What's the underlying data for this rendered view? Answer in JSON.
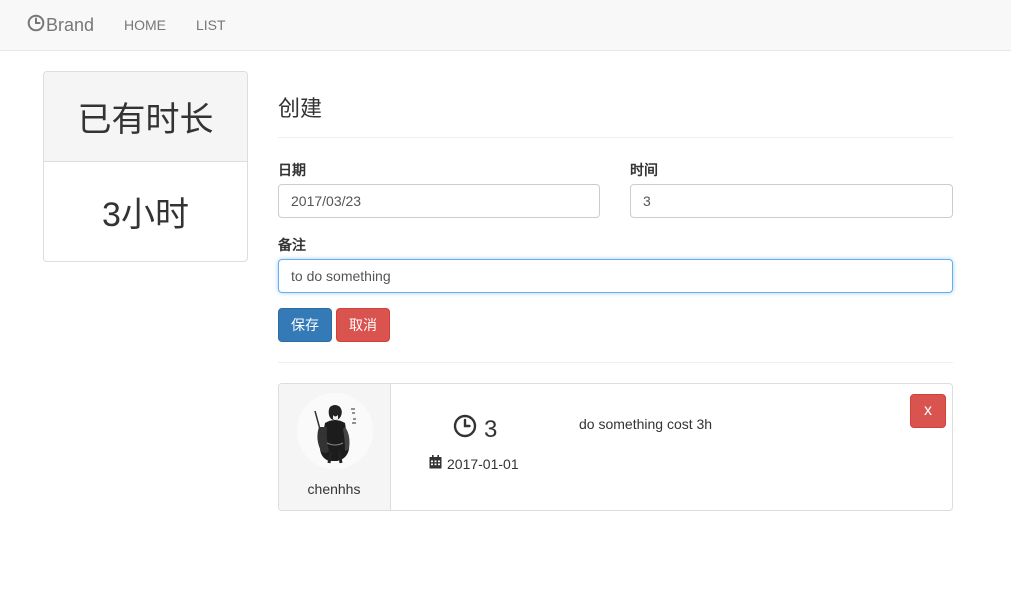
{
  "navbar": {
    "brand_label": "Brand",
    "brand_icon": "clock-icon",
    "links": [
      {
        "label": "HOME"
      },
      {
        "label": "LIST"
      }
    ]
  },
  "stats": {
    "title": "已有时长",
    "value": "3小时"
  },
  "form": {
    "title": "创建",
    "date": {
      "label": "日期",
      "value": "2017/03/23"
    },
    "time": {
      "label": "时间",
      "value": "3"
    },
    "note": {
      "label": "备注",
      "value": "to do something"
    },
    "save_label": "保存",
    "cancel_label": "取消"
  },
  "records": [
    {
      "username": "chenhhs",
      "hours": "3",
      "date": "2017-01-01",
      "description": "do something cost 3h",
      "delete_label": "x"
    }
  ],
  "colors": {
    "primary": "#337ab7",
    "danger": "#d9534f",
    "navbar_bg": "#f8f8f8",
    "panel_bg": "#f5f5f5"
  }
}
